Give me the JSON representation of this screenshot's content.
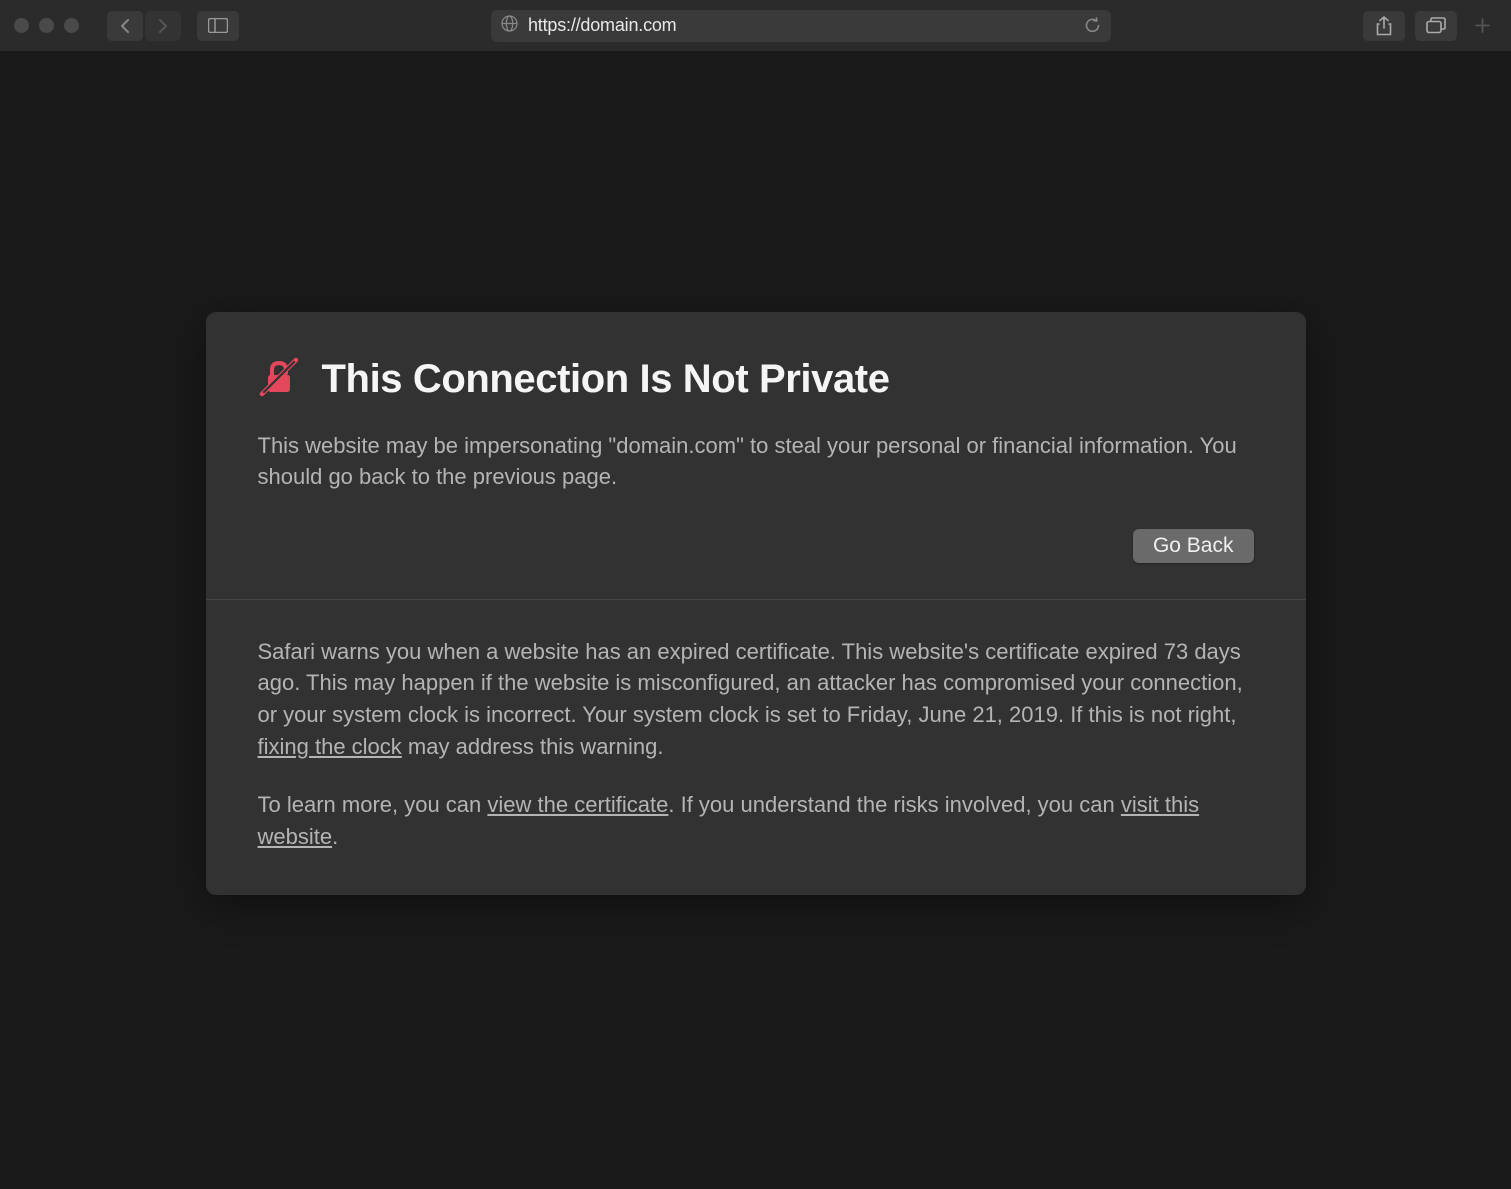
{
  "url": "https://domain.com",
  "warning": {
    "title": "This Connection Is Not Private",
    "body": "This website may be impersonating \"domain.com\" to steal your personal or financial information. You should go back to the previous page.",
    "go_back_label": "Go Back"
  },
  "details": {
    "part1_a": "Safari warns you when a website has an expired certificate. This website's certificate expired 73 days ago. This may happen if the website is misconfigured, an attacker has compromised your connection, or your system clock is incorrect. Your system clock is set to Friday, June 21, 2019. If this is not right, ",
    "fix_clock_link": "fixing the clock",
    "part1_b": " may address this warning.",
    "part2_a": "To learn more, you can ",
    "view_cert_link": "view the certificate",
    "part2_b": ". If you understand the risks involved, you can ",
    "visit_site_link": "visit this website",
    "part2_c": "."
  }
}
